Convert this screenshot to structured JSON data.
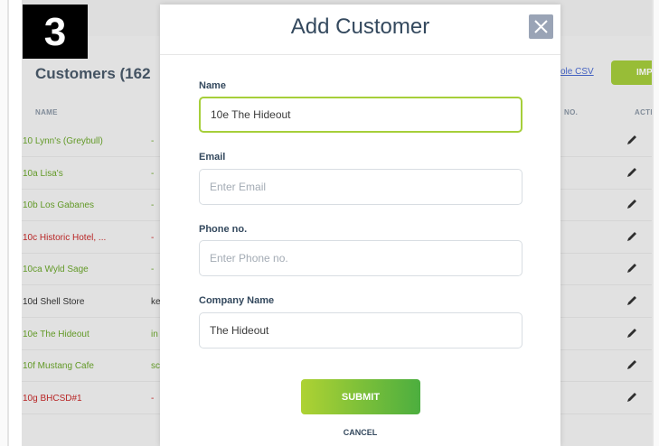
{
  "step": {
    "number": "3"
  },
  "background": {
    "title": "Customers (162",
    "sample_csv_link": "ole CSV",
    "import_label": "IMPO",
    "columns": {
      "name": "NAME",
      "phone": "NO.",
      "actions": "ACTIO"
    },
    "rows": [
      {
        "name": "10 Lynn's (Greybull)",
        "secondary": "-",
        "color": "#6aa52a"
      },
      {
        "name": "10a Lisa's",
        "secondary": "-",
        "color": "#6aa52a"
      },
      {
        "name": "10b Los Gabanes",
        "secondary": "-",
        "color": "#6aa52a"
      },
      {
        "name": "10c Historic Hotel, ...",
        "secondary": "-",
        "color": "#c62828"
      },
      {
        "name": "10ca Wyld Sage",
        "secondary": "-",
        "color": "#6aa52a"
      },
      {
        "name": "10d Shell Store",
        "secondary": "ke",
        "color": "#333333"
      },
      {
        "name": "10e The Hideout",
        "secondary": "in",
        "color": "#6aa52a"
      },
      {
        "name": "10f Mustang Cafe",
        "secondary": "sc",
        "color": "#6aa52a"
      },
      {
        "name": "10g BHCSD#1",
        "secondary": "-",
        "color": "#c62828"
      }
    ]
  },
  "modal": {
    "title": "Add Customer",
    "fields": {
      "name": {
        "label": "Name",
        "value": "10e The Hideout",
        "placeholder": ""
      },
      "email": {
        "label": "Email",
        "value": "",
        "placeholder": "Enter Email"
      },
      "phone": {
        "label": "Phone no.",
        "value": "",
        "placeholder": "Enter Phone no."
      },
      "company": {
        "label": "Company Name",
        "value": "The Hideout",
        "placeholder": ""
      }
    },
    "submit_label": "SUBMIT",
    "cancel_label": "CANCEL"
  },
  "colors": {
    "accent_green": "#a6cf3a",
    "title_dark": "#34495e",
    "close_bg": "#9aa4b6"
  },
  "icons": {
    "close": "close-icon",
    "edit": "pencil-icon"
  }
}
